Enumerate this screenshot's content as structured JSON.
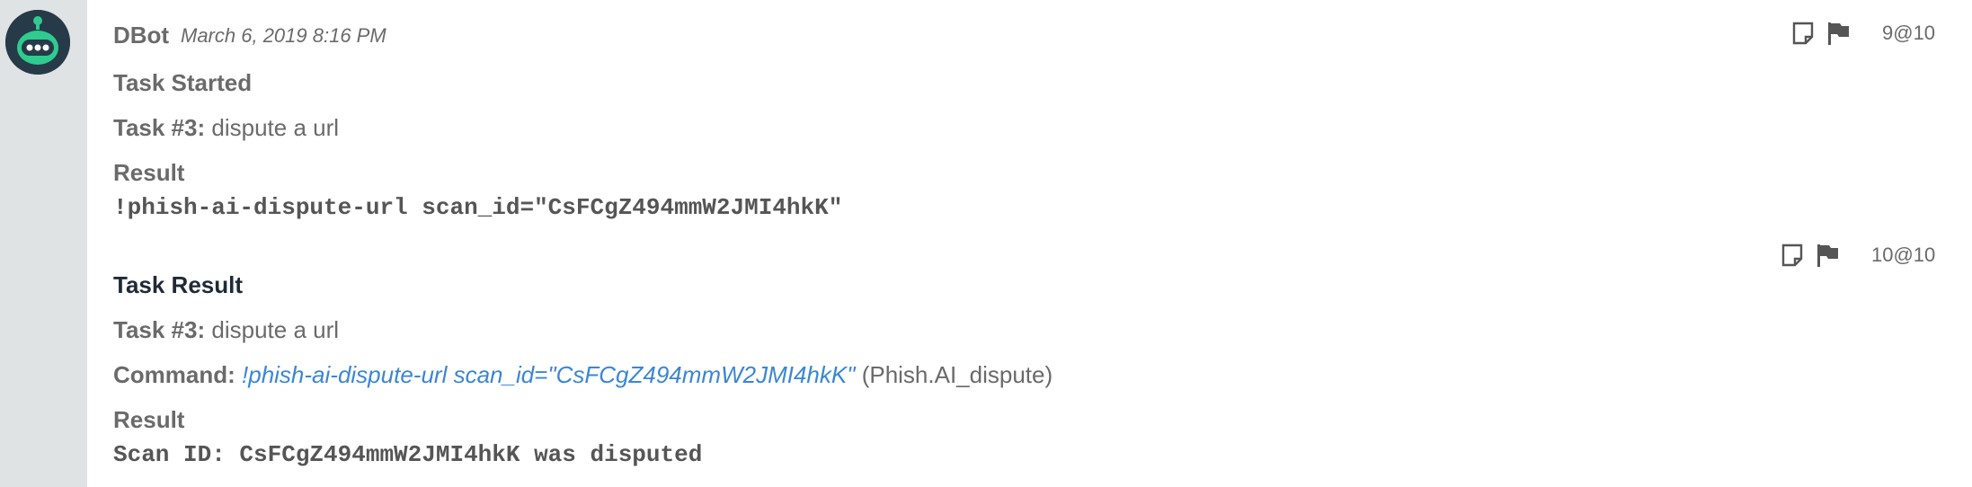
{
  "entry1": {
    "sender": "DBot",
    "timestamp": "March 6, 2019 8:16 PM",
    "title": "Task Started",
    "task_label": "Task #3:",
    "task_name": "dispute a url",
    "result_label": "Result",
    "result_text": "!phish-ai-dispute-url scan_id=\"CsFCgZ494mmW2JMI4hkK\"",
    "count": "9@10"
  },
  "entry2": {
    "title": "Task Result",
    "task_label": "Task #3:",
    "task_name": "dispute a url",
    "command_label": "Command:",
    "command_text": "!phish-ai-dispute-url scan_id=\"CsFCgZ494mmW2JMI4hkK\"",
    "command_source": "(Phish.AI_dispute)",
    "result_label": "Result",
    "result_text": "Scan ID: CsFCgZ494mmW2JMI4hkK was disputed",
    "count": "10@10"
  },
  "icons": {
    "avatar": "robot-avatar-icon",
    "note": "note-icon",
    "flag": "flag-icon"
  },
  "colors": {
    "gutter": "#dfe3e4",
    "avatar_bg": "#263a48",
    "avatar_face": "#2ecc8f",
    "text": "#6a6a6a",
    "link": "#3a86d4"
  }
}
